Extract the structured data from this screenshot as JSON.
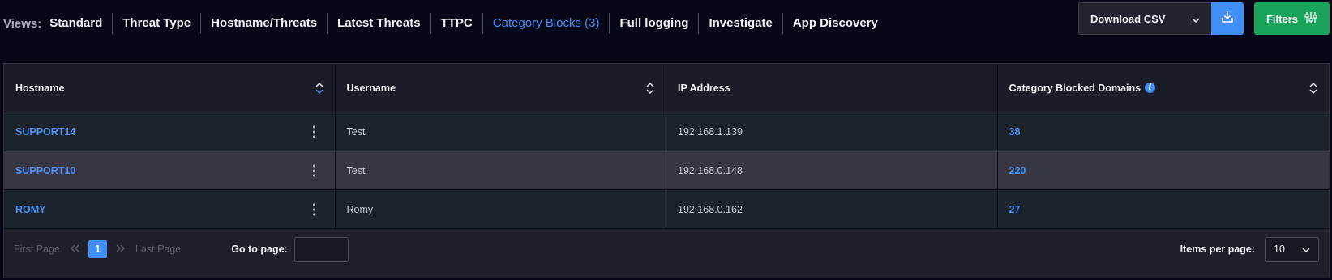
{
  "views": {
    "label": "Views:",
    "tabs": [
      "Standard",
      "Threat Type",
      "Hostname/Threats",
      "Latest Threats",
      "TTPC",
      "Category Blocks (3)",
      "Full logging",
      "Investigate",
      "App Discovery"
    ],
    "active_index": 5
  },
  "toolbar": {
    "download_label": "Download CSV",
    "filters_label": "Filters"
  },
  "table": {
    "headers": [
      "Hostname",
      "Username",
      "IP Address",
      "Category Blocked Domains"
    ],
    "rows": [
      {
        "hostname": "SUPPORT14",
        "username": "Test",
        "ip": "192.168.1.139",
        "blocked": "38"
      },
      {
        "hostname": "SUPPORT10",
        "username": "Test",
        "ip": "192.168.0.148",
        "blocked": "220"
      },
      {
        "hostname": "ROMY",
        "username": "Romy",
        "ip": "192.168.0.162",
        "blocked": "27"
      }
    ]
  },
  "pagination": {
    "first_label": "First Page",
    "current_page": "1",
    "last_label": "Last Page",
    "goto_label": "Go to page:",
    "goto_value": "",
    "items_per_page_label": "Items per page:",
    "items_per_page": "10"
  },
  "colors": {
    "accent": "#3f8ff7",
    "filters_green": "#1aa35b",
    "background": "#070718"
  }
}
